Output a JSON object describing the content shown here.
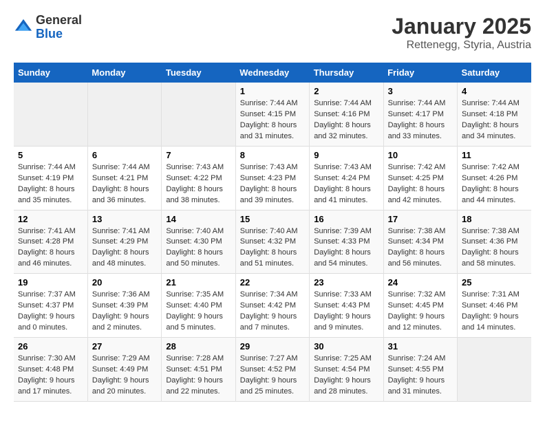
{
  "logo": {
    "general": "General",
    "blue": "Blue"
  },
  "title": "January 2025",
  "subtitle": "Rettenegg, Styria, Austria",
  "weekdays": [
    "Sunday",
    "Monday",
    "Tuesday",
    "Wednesday",
    "Thursday",
    "Friday",
    "Saturday"
  ],
  "weeks": [
    [
      {
        "day": "",
        "empty": true
      },
      {
        "day": "",
        "empty": true
      },
      {
        "day": "",
        "empty": true
      },
      {
        "day": "1",
        "sunrise": "7:44 AM",
        "sunset": "4:15 PM",
        "daylight": "8 hours and 31 minutes."
      },
      {
        "day": "2",
        "sunrise": "7:44 AM",
        "sunset": "4:16 PM",
        "daylight": "8 hours and 32 minutes."
      },
      {
        "day": "3",
        "sunrise": "7:44 AM",
        "sunset": "4:17 PM",
        "daylight": "8 hours and 33 minutes."
      },
      {
        "day": "4",
        "sunrise": "7:44 AM",
        "sunset": "4:18 PM",
        "daylight": "8 hours and 34 minutes."
      }
    ],
    [
      {
        "day": "5",
        "sunrise": "7:44 AM",
        "sunset": "4:19 PM",
        "daylight": "8 hours and 35 minutes."
      },
      {
        "day": "6",
        "sunrise": "7:44 AM",
        "sunset": "4:21 PM",
        "daylight": "8 hours and 36 minutes."
      },
      {
        "day": "7",
        "sunrise": "7:43 AM",
        "sunset": "4:22 PM",
        "daylight": "8 hours and 38 minutes."
      },
      {
        "day": "8",
        "sunrise": "7:43 AM",
        "sunset": "4:23 PM",
        "daylight": "8 hours and 39 minutes."
      },
      {
        "day": "9",
        "sunrise": "7:43 AM",
        "sunset": "4:24 PM",
        "daylight": "8 hours and 41 minutes."
      },
      {
        "day": "10",
        "sunrise": "7:42 AM",
        "sunset": "4:25 PM",
        "daylight": "8 hours and 42 minutes."
      },
      {
        "day": "11",
        "sunrise": "7:42 AM",
        "sunset": "4:26 PM",
        "daylight": "8 hours and 44 minutes."
      }
    ],
    [
      {
        "day": "12",
        "sunrise": "7:41 AM",
        "sunset": "4:28 PM",
        "daylight": "8 hours and 46 minutes."
      },
      {
        "day": "13",
        "sunrise": "7:41 AM",
        "sunset": "4:29 PM",
        "daylight": "8 hours and 48 minutes."
      },
      {
        "day": "14",
        "sunrise": "7:40 AM",
        "sunset": "4:30 PM",
        "daylight": "8 hours and 50 minutes."
      },
      {
        "day": "15",
        "sunrise": "7:40 AM",
        "sunset": "4:32 PM",
        "daylight": "8 hours and 51 minutes."
      },
      {
        "day": "16",
        "sunrise": "7:39 AM",
        "sunset": "4:33 PM",
        "daylight": "8 hours and 54 minutes."
      },
      {
        "day": "17",
        "sunrise": "7:38 AM",
        "sunset": "4:34 PM",
        "daylight": "8 hours and 56 minutes."
      },
      {
        "day": "18",
        "sunrise": "7:38 AM",
        "sunset": "4:36 PM",
        "daylight": "8 hours and 58 minutes."
      }
    ],
    [
      {
        "day": "19",
        "sunrise": "7:37 AM",
        "sunset": "4:37 PM",
        "daylight": "9 hours and 0 minutes."
      },
      {
        "day": "20",
        "sunrise": "7:36 AM",
        "sunset": "4:39 PM",
        "daylight": "9 hours and 2 minutes."
      },
      {
        "day": "21",
        "sunrise": "7:35 AM",
        "sunset": "4:40 PM",
        "daylight": "9 hours and 5 minutes."
      },
      {
        "day": "22",
        "sunrise": "7:34 AM",
        "sunset": "4:42 PM",
        "daylight": "9 hours and 7 minutes."
      },
      {
        "day": "23",
        "sunrise": "7:33 AM",
        "sunset": "4:43 PM",
        "daylight": "9 hours and 9 minutes."
      },
      {
        "day": "24",
        "sunrise": "7:32 AM",
        "sunset": "4:45 PM",
        "daylight": "9 hours and 12 minutes."
      },
      {
        "day": "25",
        "sunrise": "7:31 AM",
        "sunset": "4:46 PM",
        "daylight": "9 hours and 14 minutes."
      }
    ],
    [
      {
        "day": "26",
        "sunrise": "7:30 AM",
        "sunset": "4:48 PM",
        "daylight": "9 hours and 17 minutes."
      },
      {
        "day": "27",
        "sunrise": "7:29 AM",
        "sunset": "4:49 PM",
        "daylight": "9 hours and 20 minutes."
      },
      {
        "day": "28",
        "sunrise": "7:28 AM",
        "sunset": "4:51 PM",
        "daylight": "9 hours and 22 minutes."
      },
      {
        "day": "29",
        "sunrise": "7:27 AM",
        "sunset": "4:52 PM",
        "daylight": "9 hours and 25 minutes."
      },
      {
        "day": "30",
        "sunrise": "7:25 AM",
        "sunset": "4:54 PM",
        "daylight": "9 hours and 28 minutes."
      },
      {
        "day": "31",
        "sunrise": "7:24 AM",
        "sunset": "4:55 PM",
        "daylight": "9 hours and 31 minutes."
      },
      {
        "day": "",
        "empty": true
      }
    ]
  ],
  "labels": {
    "sunrise": "Sunrise:",
    "sunset": "Sunset:",
    "daylight": "Daylight:"
  }
}
